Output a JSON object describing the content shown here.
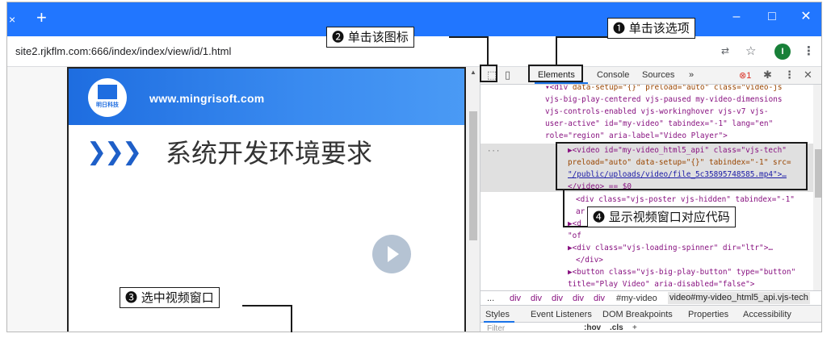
{
  "browser": {
    "tab_close": "×",
    "new_tab": "+",
    "url": "site2.rjkflm.com:666/index/index/view/id/1.html",
    "window_controls": [
      "–",
      "□",
      "✕"
    ],
    "avatar_initial": "I",
    "icons": {
      "translate": "translate-icon",
      "star": "star-icon",
      "menu": "kebab-menu-icon"
    }
  },
  "page": {
    "site_url": "www.mingrisoft.com",
    "logo_text": "明日科技",
    "slide_title": "系统开发环境要求"
  },
  "devtools": {
    "tabs": [
      "Elements",
      "Console",
      "Sources",
      "»"
    ],
    "active_tab": "Elements",
    "error_count": "1",
    "code_lines": {
      "l1": "data-setup=\"{}\" preload=\"auto\" class=\"video-js",
      "l2": "vjs-big-play-centered vjs-paused my-video-dimensions",
      "l3": "vjs-controls-enabled vjs-workinghover vjs-v7 vjs-",
      "l4": "user-active\" id=\"my-video\" tabindex=\"-1\" lang=\"en\"",
      "l5": "role=\"region\" aria-label=\"Video Player\">",
      "s1": "▶<video id=\"my-video_html5_api\" class=\"vjs-tech\"",
      "s2": "preload=\"auto\" data-setup=\"{}\" tabindex=\"-1\" src=",
      "s3": "\"/public/uploads/video/file_5c35895748585.mp4\">…",
      "s4": "</video> == $0",
      "l6": "<div class=\"vjs-poster vjs-hidden\" tabindex=\"-1\"",
      "l7": "ar",
      "l8": "▶<d",
      "l9": "\"of",
      "l10": "▶<div class=\"vjs-loading-spinner\" dir=\"ltr\">…",
      "l11": "</div>",
      "l12": "▶<button class=\"vjs-big-play-button\" type=\"button\"",
      "l13": "title=\"Play Video\" aria-disabled=\"false\">"
    },
    "breadcrumb": [
      "...",
      "div",
      "div",
      "div",
      "div",
      "div",
      "#my-video",
      "video#my-video_html5_api.vjs-tech"
    ],
    "sub_tabs": [
      "Styles",
      "Event Listeners",
      "DOM Breakpoints",
      "Properties",
      "Accessibility"
    ],
    "filter_placeholder": "Filter",
    "filter_hov": ":hov",
    "filter_cls": ".cls",
    "filter_plus": "+"
  },
  "annotations": {
    "step1": "❶ 单击该选项",
    "step2": "❷ 单击该图标",
    "step3": "❸ 选中视频窗口",
    "step4": "❹ 显示视频窗口对应代码"
  }
}
